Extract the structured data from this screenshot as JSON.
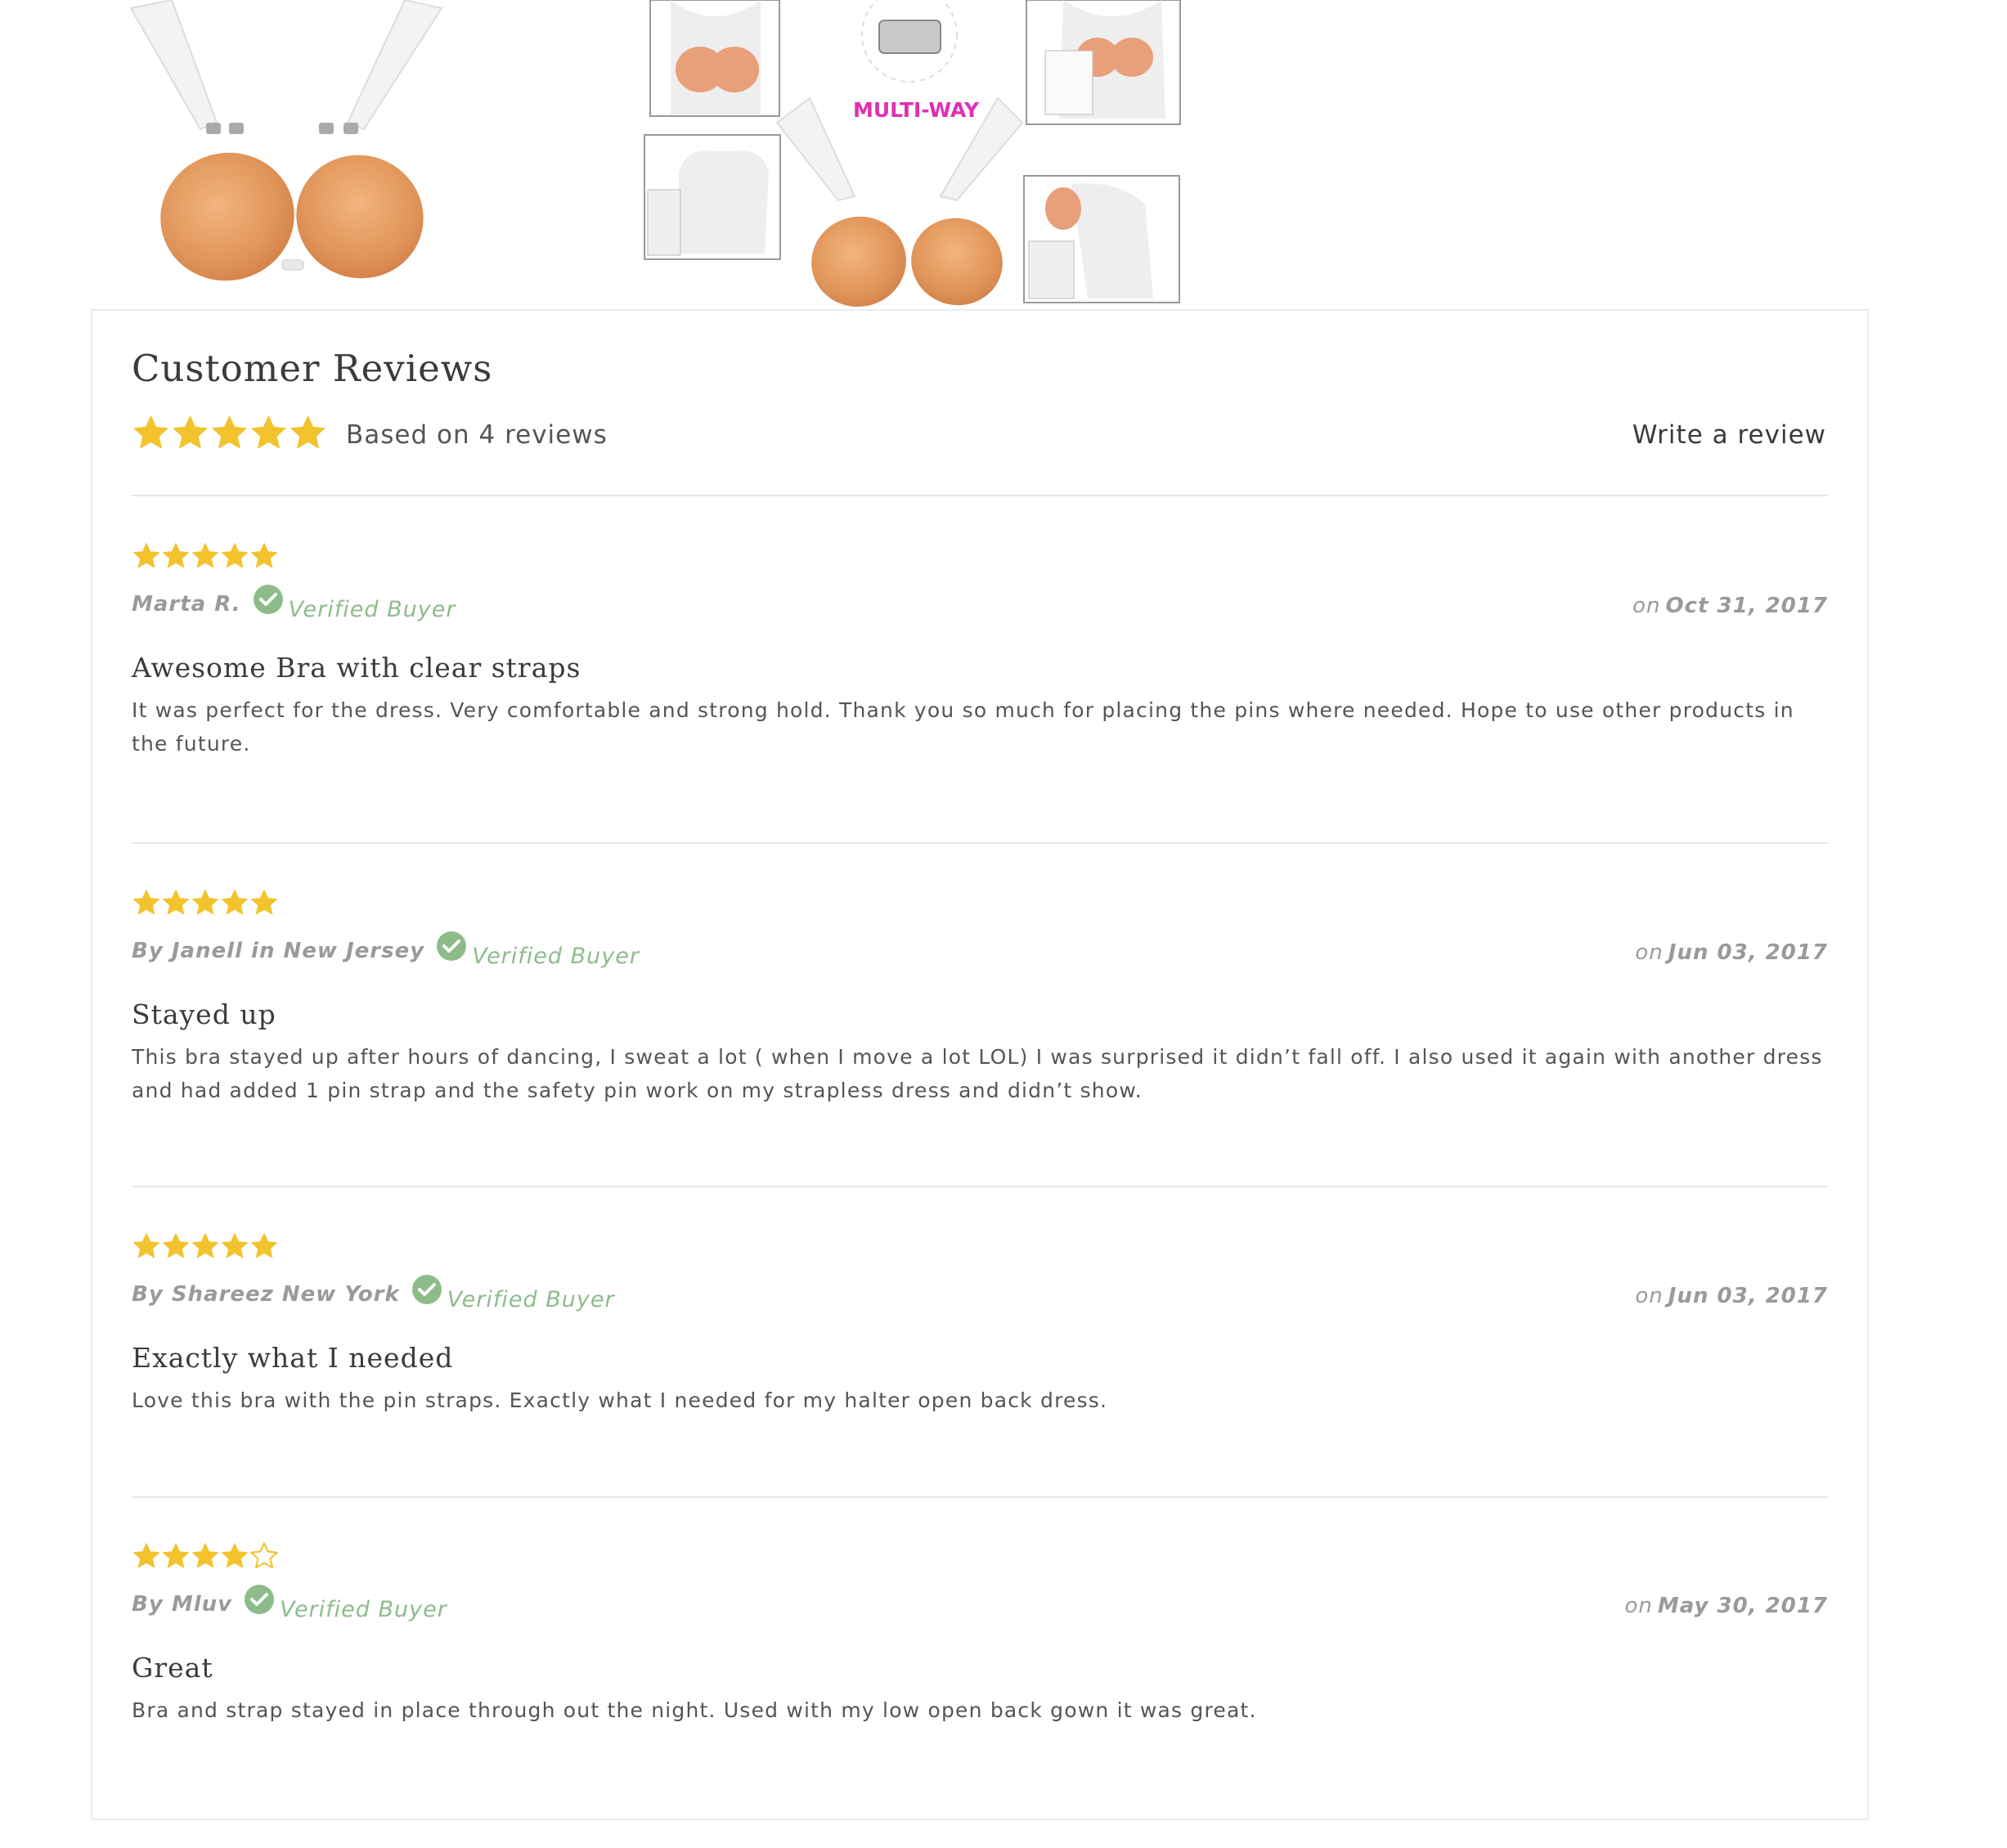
{
  "product_images": {
    "collage_badge": "MULTI-WAY"
  },
  "reviews_section": {
    "title": "Customer Reviews",
    "average_rating": 5,
    "summary_text": "Based on 4 reviews",
    "write_review_label": "Write a review",
    "verified_label": "Verified Buyer",
    "date_prefix": "on",
    "star_color": "#f2c32d",
    "verified_color": "#8dbc8a"
  },
  "reviews": [
    {
      "rating": 5,
      "author": "Marta R.",
      "verified": true,
      "date": "Oct 31, 2017",
      "title": "Awesome Bra with clear straps",
      "body": "It was perfect for the dress. Very comfortable and strong hold. Thank you so much for placing the pins where needed. Hope to use other products in the future."
    },
    {
      "rating": 5,
      "author": "By Janell in New Jersey",
      "verified": true,
      "date": "Jun 03, 2017",
      "title": "Stayed up",
      "body": "This bra stayed up after hours of dancing, I sweat a lot ( when I move a lot LOL) I was surprised it didn’t fall off. I also used it again with another dress and had added 1 pin strap and the safety pin work on my strapless dress and didn’t show."
    },
    {
      "rating": 5,
      "author": "By Shareez New York",
      "verified": true,
      "date": "Jun 03, 2017",
      "title": "Exactly what I needed",
      "body": "Love this bra with the pin straps. Exactly what I needed for my halter open back dress."
    },
    {
      "rating": 4,
      "author": "By Mluv",
      "verified": true,
      "date": "May 30, 2017",
      "title": "Great",
      "body": "Bra and strap stayed in place through out the night. Used with my low open back gown it was great."
    }
  ]
}
